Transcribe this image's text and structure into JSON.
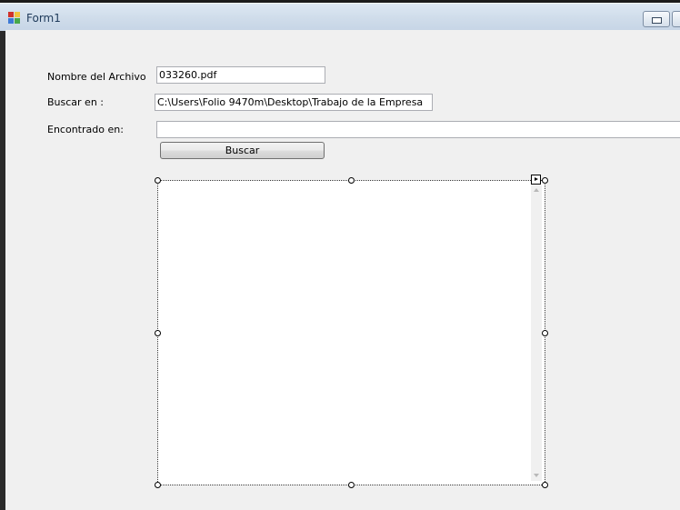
{
  "window": {
    "title": "Form1",
    "icon": "windows-form-icon",
    "controls": [
      "minimize-icon",
      "maximize-icon"
    ]
  },
  "form": {
    "file_name_label": "Nombre del Archivo",
    "file_name_value": "033260.pdf",
    "search_in_label": "Buscar en :",
    "search_in_value": "C:\\Users\\Folio 9470m\\Desktop\\Trabajo de la Empresa",
    "found_in_label": "Encontrado en:",
    "found_in_value": "",
    "search_button_label": "Buscar"
  },
  "results_list": {
    "items": [],
    "scrollbar_icons": [
      "scroll-up-arrow-icon",
      "scroll-down-arrow-icon"
    ],
    "smart_tag_icon": "smart-tag-arrow-icon"
  }
}
